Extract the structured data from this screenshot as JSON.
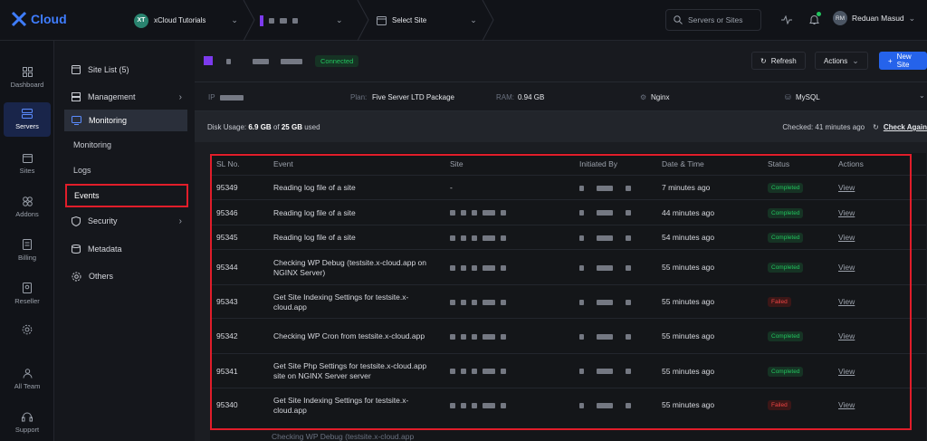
{
  "brand": {
    "name": "Cloud"
  },
  "topbar": {
    "team_initials": "XT",
    "team_name": "xCloud Tutorials",
    "select_site": "Select Site",
    "search_placeholder": "Servers or Sites",
    "user_initials": "RM",
    "user_name": "Reduan Masud"
  },
  "rail": [
    {
      "label": "Dashboard"
    },
    {
      "label": "Servers"
    },
    {
      "label": "Sites"
    },
    {
      "label": "Addons"
    },
    {
      "label": "Billing"
    },
    {
      "label": "Reseller"
    },
    {
      "label": "All Team"
    },
    {
      "label": "Support"
    }
  ],
  "sidebar": {
    "site_list": "Site List (5)",
    "management": "Management",
    "monitoring": "Monitoring",
    "monitoring_sub": "Monitoring",
    "logs": "Logs",
    "events": "Events",
    "security": "Security",
    "metadata": "Metadata",
    "others": "Others"
  },
  "site": {
    "status": "Connected",
    "refresh": "Refresh",
    "actions": "Actions",
    "new_site": "New Site"
  },
  "info": {
    "ip_label": "IP",
    "plan_label": "Plan:",
    "plan_value": "Five Server LTD Package",
    "ram_label": "RAM:",
    "ram_value": "0.94 GB",
    "web_server": "Nginx",
    "database": "MySQL"
  },
  "disk": {
    "label": "Disk Usage:",
    "used": "6.9 GB",
    "of": "of",
    "total": "25 GB",
    "suffix": "used",
    "checked": "Checked: 41 minutes ago",
    "check_again": "Check Again"
  },
  "table": {
    "headers": [
      "SL No.",
      "Event",
      "Site",
      "Initiated By",
      "Date & Time",
      "Status",
      "Actions"
    ],
    "rows": [
      {
        "sl": "95349",
        "event": "Reading log file of a site",
        "site": "-",
        "time": "7 minutes ago",
        "status": "Completed",
        "action": "View"
      },
      {
        "sl": "95346",
        "event": "Reading log file of a site",
        "site": "",
        "time": "44 minutes ago",
        "status": "Completed",
        "action": "View"
      },
      {
        "sl": "95345",
        "event": "Reading log file of a site",
        "site": "",
        "time": "54 minutes ago",
        "status": "Completed",
        "action": "View"
      },
      {
        "sl": "95344",
        "event": "Checking WP Debug (testsite.x-cloud.app on NGINX Server)",
        "site": "",
        "time": "55 minutes ago",
        "status": "Completed",
        "action": "View"
      },
      {
        "sl": "95343",
        "event": "Get Site Indexing Settings for testsite.x-cloud.app",
        "site": "",
        "time": "55 minutes ago",
        "status": "Failed",
        "action": "View"
      },
      {
        "sl": "95342",
        "event": "Checking WP Cron from testsite.x-cloud.app",
        "site": "",
        "time": "55 minutes ago",
        "status": "Completed",
        "action": "View"
      },
      {
        "sl": "95341",
        "event": "Get Site Php Settings for testsite.x-cloud.app site on NGINX Server server",
        "site": "",
        "time": "55 minutes ago",
        "status": "Completed",
        "action": "View"
      },
      {
        "sl": "95340",
        "event": "Get Site Indexing Settings for testsite.x-cloud.app",
        "site": "",
        "time": "55 minutes ago",
        "status": "Failed",
        "action": "View"
      }
    ],
    "partial_row_event": "Checking WP Debug (testsite.x-cloud.app"
  },
  "colors": {
    "accent": "#2563eb",
    "success": "#22c55e",
    "danger": "#ef4444",
    "highlight": "#e11d2a"
  }
}
